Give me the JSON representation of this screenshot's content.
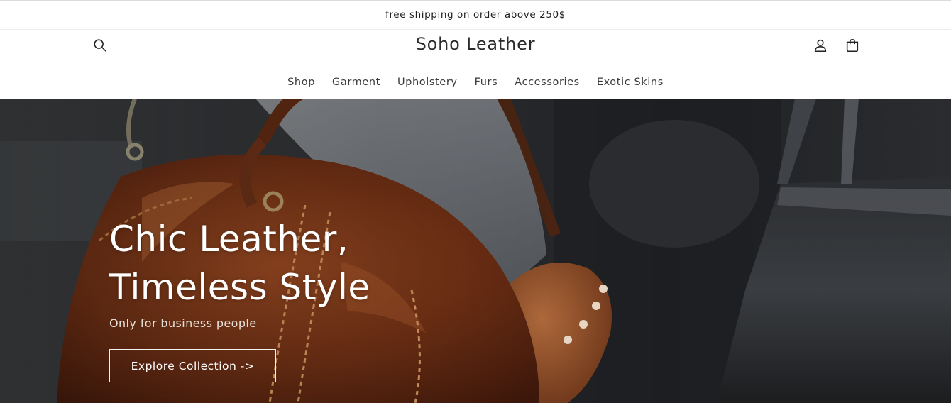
{
  "announcement": {
    "text": "free shipping on order above 250$"
  },
  "header": {
    "brand": "Soho Leather",
    "icons": {
      "search": "search-icon",
      "account": "user-icon",
      "cart": "cart-icon"
    }
  },
  "nav": {
    "items": [
      {
        "label": "Shop"
      },
      {
        "label": "Garment"
      },
      {
        "label": "Upholstery"
      },
      {
        "label": "Furs"
      },
      {
        "label": "Accessories"
      },
      {
        "label": "Exotic Skins"
      }
    ]
  },
  "hero": {
    "title_line1": "Chic Leather,",
    "title_line2": "Timeless Style",
    "subtitle": "Only for business people",
    "cta_label": "Explore Collection ->"
  },
  "colors": {
    "text": "#222222",
    "hero_text": "#ffffff",
    "bag_leather": "#7a3a1a"
  }
}
